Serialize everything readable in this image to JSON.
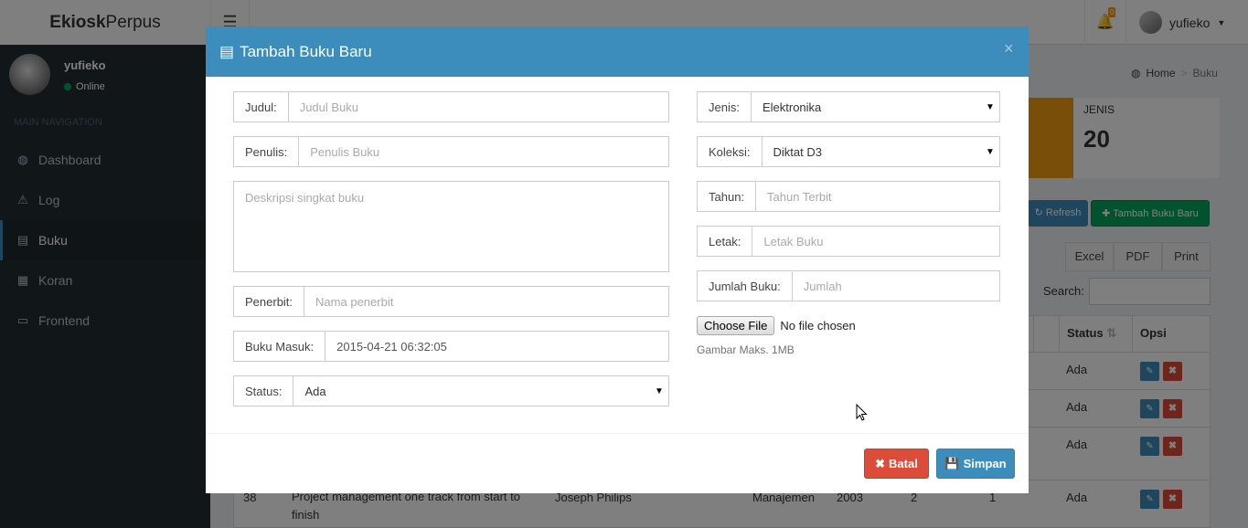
{
  "app": {
    "logo_bold": "Ekiosk",
    "logo_light": "Perpus",
    "notif_count": "0"
  },
  "header": {
    "user_name": "yufieko"
  },
  "sidebar": {
    "user_name": "yufieko",
    "status": "Online",
    "nav_header": "MAIN NAVIGATION",
    "items": [
      {
        "label": "Dashboard",
        "icon": "dashboard-icon"
      },
      {
        "label": "Log",
        "icon": "warning-icon"
      },
      {
        "label": "Buku",
        "icon": "book-icon"
      },
      {
        "label": "Koran",
        "icon": "newspaper-icon"
      },
      {
        "label": "Frontend",
        "icon": "desktop-icon"
      }
    ]
  },
  "background": {
    "breadcrumb": [
      "Home",
      "Buku"
    ],
    "info_label": "JENIS",
    "info_value": "20",
    "refresh_label": "Refresh",
    "add_label": "Tambah Buku Baru",
    "export": [
      "Excel",
      "PDF",
      "Print"
    ],
    "search_label": "Search:",
    "col_status": "Status",
    "col_opsi": "Opsi",
    "rows": [
      {
        "status": "Ada"
      },
      {
        "status": "Ada"
      },
      {
        "status": "Ada"
      },
      {
        "id": "38",
        "title": "Project management one track from start to finish",
        "author": "Joseph Philips",
        "category": "Manajemen",
        "year": "2003",
        "c1": "2",
        "c2": "1",
        "status": "Ada"
      }
    ]
  },
  "modal": {
    "title": "Tambah Buku Baru",
    "close": "×",
    "judul": {
      "label": "Judul:",
      "placeholder": "Judul Buku"
    },
    "penulis": {
      "label": "Penulis:",
      "placeholder": "Penulis Buku"
    },
    "deskripsi": {
      "placeholder": "Deskripsi singkat buku"
    },
    "penerbit": {
      "label": "Penerbit:",
      "placeholder": "Nama penerbit"
    },
    "buku_masuk": {
      "label": "Buku Masuk:",
      "value": "2015-04-21 06:32:05"
    },
    "status": {
      "label": "Status:",
      "value": "Ada"
    },
    "jenis": {
      "label": "Jenis:",
      "value": "Elektronika"
    },
    "koleksi": {
      "label": "Koleksi:",
      "value": "Diktat D3"
    },
    "tahun": {
      "label": "Tahun:",
      "placeholder": "Tahun Terbit"
    },
    "letak": {
      "label": "Letak:",
      "placeholder": "Letak Buku"
    },
    "jumlah": {
      "label": "Jumlah Buku:",
      "placeholder": "Jumlah"
    },
    "file": {
      "button": "Choose File",
      "status": "No file chosen",
      "help": "Gambar Maks. 1MB"
    },
    "batal_label": "Batal",
    "simpan_label": "Simpan"
  },
  "colors": {
    "primary": "#3c8dbc",
    "danger": "#dd4b39",
    "success": "#00a65a",
    "warning": "#f39c12",
    "sidebar": "#222d32"
  }
}
